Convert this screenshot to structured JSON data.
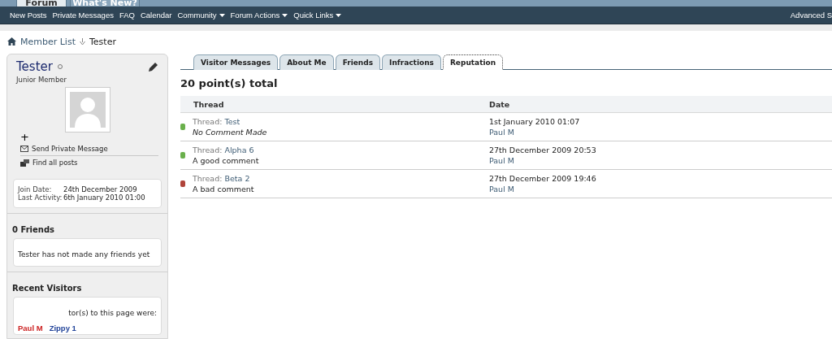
{
  "top_tabs": [
    {
      "label": "Forum",
      "selected": true
    },
    {
      "label": "What's New?",
      "selected": false
    }
  ],
  "navbar": {
    "links": [
      {
        "label": "New Posts",
        "dropdown": false
      },
      {
        "label": "Private Messages",
        "dropdown": false
      },
      {
        "label": "FAQ",
        "dropdown": false
      },
      {
        "label": "Calendar",
        "dropdown": false
      },
      {
        "label": "Community",
        "dropdown": true
      },
      {
        "label": "Forum Actions",
        "dropdown": true
      },
      {
        "label": "Quick Links",
        "dropdown": true
      }
    ],
    "right_link": "Advanced S"
  },
  "breadcrumb": {
    "parent": "Member List",
    "current": "Tester"
  },
  "profile": {
    "username": "Tester",
    "online": false,
    "rank": "Junior Member",
    "add_label": "+",
    "actions": [
      {
        "kind": "message",
        "label": "Send Private Message"
      },
      {
        "kind": "posts",
        "label": "Find all posts"
      }
    ],
    "stats": [
      {
        "label": "Join Date:",
        "value": "24th December 2009"
      },
      {
        "label": "Last Activity:",
        "value": "6th January 2010 01:00"
      }
    ]
  },
  "friends": {
    "title": "0 Friends",
    "text": "Tester has not made any friends yet"
  },
  "recent_visitors": {
    "title": "Recent Visitors",
    "text": "tor(s) to this page were:",
    "visitors": [
      {
        "name": "Paul M",
        "color": "#cc2222"
      },
      {
        "name": "Zippy 1",
        "color": "#22449a"
      }
    ]
  },
  "tabs": [
    {
      "label": "Visitor Messages",
      "selected": false
    },
    {
      "label": "About Me",
      "selected": false
    },
    {
      "label": "Friends",
      "selected": false
    },
    {
      "label": "Infractions",
      "selected": false
    },
    {
      "label": "Reputation",
      "selected": true
    }
  ],
  "reputation": {
    "total": "20 point(s) total",
    "columns": [
      "Thread",
      "Date"
    ],
    "rows": [
      {
        "color": "#6ab04c",
        "thread_prefix": "Thread:",
        "thread": "Test",
        "comment": "No Comment Made",
        "no_comment": true,
        "date": "1st January 2010 01:07",
        "user": "Paul M"
      },
      {
        "color": "#6ab04c",
        "thread_prefix": "Thread:",
        "thread": "Alpha 6",
        "comment": "A good comment",
        "no_comment": false,
        "date": "27th December 2009 20:53",
        "user": "Paul M"
      },
      {
        "color": "#b0443a",
        "thread_prefix": "Thread:",
        "thread": "Beta 2",
        "comment": "A bad comment",
        "no_comment": false,
        "date": "27th December 2009 19:46",
        "user": "Paul M"
      }
    ]
  }
}
